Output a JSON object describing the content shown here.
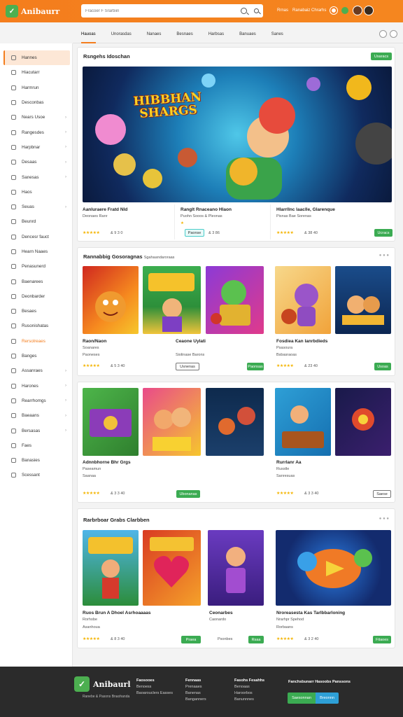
{
  "brand": {
    "name": "Anibaurr",
    "logo_mark": "✓",
    "accent": "#f47d1d",
    "green": "#3bab52"
  },
  "search": {
    "placeholder": "Fracoer F Srarbiin"
  },
  "top_right": {
    "link": "Rrnas",
    "label": "Ranabaiz Chrarhs"
  },
  "nav": {
    "tabs": [
      "Hauoas",
      "Unorasdas",
      "Nanaes",
      "Besnaes",
      "Harbsas",
      "Banuaes",
      "Sanes"
    ]
  },
  "sidebar": {
    "items": [
      {
        "label": "Hannes",
        "chev": false
      },
      {
        "label": "Hiacutarr",
        "chev": false
      },
      {
        "label": "Harmrun",
        "chev": false
      },
      {
        "label": "Desconbas",
        "chev": false
      },
      {
        "label": "Nears Usoe",
        "chev": true
      },
      {
        "label": "Rangesdes",
        "chev": true
      },
      {
        "label": "Harpbnar",
        "chev": true
      },
      {
        "label": "Desaas",
        "chev": true
      },
      {
        "label": "Sanesas",
        "chev": true
      },
      {
        "label": "Haos",
        "chev": false
      },
      {
        "label": "Seuas",
        "chev": true
      },
      {
        "label": "Beunrd",
        "chev": false
      },
      {
        "label": "Dencesr fauct",
        "chev": false
      },
      {
        "label": "Hearn Naaes",
        "chev": false
      },
      {
        "label": "Penasunerd",
        "chev": false
      },
      {
        "label": "Baenarees",
        "chev": false
      },
      {
        "label": "Deonbarder",
        "chev": false
      },
      {
        "label": "Besaes",
        "chev": false
      },
      {
        "label": "Rusonishatas",
        "chev": false
      },
      {
        "label": "Rersolreaes",
        "chev": false
      },
      {
        "label": "Banges",
        "chev": false
      },
      {
        "label": "Assanraes",
        "chev": true
      },
      {
        "label": "Harones",
        "chev": true
      },
      {
        "label": "Rearrhomgs",
        "chev": true
      },
      {
        "label": "Baeaans",
        "chev": true
      },
      {
        "label": "Bersasas",
        "chev": true
      },
      {
        "label": "Faes",
        "chev": false
      },
      {
        "label": "Banasies",
        "chev": false
      },
      {
        "label": "Scessant",
        "chev": false
      }
    ]
  },
  "featured": {
    "title": "Rsngehs Idoschan",
    "button": "Usaracs",
    "banner_text": "HIBBHAN SHARGS",
    "cards": [
      {
        "title": "Aanluraere Fratd Nld",
        "sub": "Deonaes Ranr",
        "rating": "& 9 3 0",
        "button": ""
      },
      {
        "title": "Ranglt Rnaceano Hlaon",
        "sub": "Puohn Sooos & Pleonas",
        "rating": "& 3 86",
        "button": "Paonse"
      },
      {
        "title": "Hlarrllnc laaclle, Glarenque",
        "sub": "Pisnas Bae Sorenas",
        "rating": "& 38 40",
        "button": "Ucracs"
      }
    ]
  },
  "section2": {
    "title": "Rannabbig Gosoragnas",
    "subtitle": "Sgahaandaroraas",
    "rows": [
      [
        {
          "title": "Raon/Naon",
          "sub": "Soanares",
          "sub2": "Paoneses",
          "rating": "& 5 3 40",
          "button": ""
        },
        {
          "title": "Ceaone Uylati",
          "sub": "Siolinase Barons",
          "rating": "",
          "button": "Usnenas",
          "button2": "Paonsas"
        },
        {
          "title": "Fosdiea Kan lanrbdieds",
          "sub": "Psasoura",
          "sub2": "Bsbasraoas",
          "rating": "& 23 40",
          "button": "Usoas"
        }
      ],
      [
        {
          "title": "Adnnbhorne Bhr Grgs",
          "sub": "Paseamun",
          "sub2": "Saanaa",
          "rating": "& 3 3 40",
          "button": "Ubonanas"
        },
        {
          "title": "Rurrlanr Aa",
          "sub": "Russtle",
          "sub2": "Sanresuas",
          "rating": "& 3 3 40",
          "button": "Saese"
        }
      ]
    ]
  },
  "section3": {
    "title": "Rarbrboar Grabs Clarbben",
    "cards": [
      {
        "title": "Ruos Brun A Dhoel Asrhoaaaas",
        "sub": "Rorhobe",
        "sub2": "Asanhoua",
        "rating": "& 8 3 40",
        "button": "Praea"
      },
      {
        "title": "Ceonarbes",
        "sub": "Caonardo",
        "rating": "Psonbes",
        "button": "Rsaa"
      },
      {
        "title": "Nroreasesta Kas Tarlbbarloning",
        "sub": "Nrarhpr Spehod",
        "sub2": "Rorbaans",
        "rating": "& 3 2 40",
        "button": "Fitaoes"
      }
    ]
  },
  "footer": {
    "brand": "Anibaurl",
    "brand_sub": "Ranebe & Pasons Bnaohanda",
    "cols": [
      {
        "head": "Faosooes",
        "items": [
          "Benoess",
          "Baoarouclers Easses"
        ]
      },
      {
        "head": "Fennaas",
        "items": [
          "Prenaaes",
          "Banenas",
          "Banganners"
        ]
      },
      {
        "head": "Fasohs Fesahhs",
        "items": [
          "Benoaas",
          "Haroorbos",
          "Banunnnes"
        ]
      }
    ],
    "signup_label": "Fanchsbunarr Hasoobs Panssons",
    "btn_green": "Saesonnan",
    "btn_blue": "Breonnn"
  }
}
